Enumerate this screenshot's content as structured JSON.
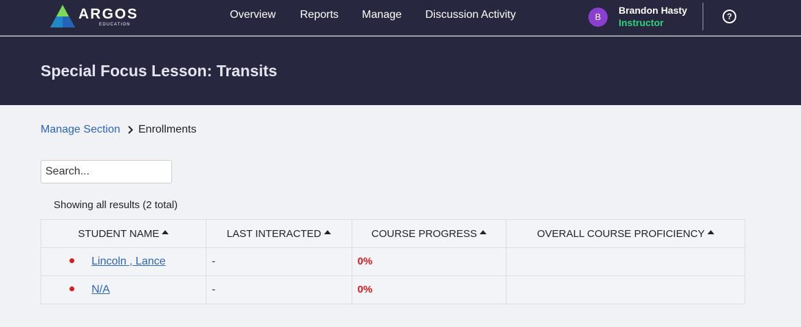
{
  "brand": {
    "name": "ARGOS",
    "sub": "EDUCATION"
  },
  "nav": [
    "Overview",
    "Reports",
    "Manage",
    "Discussion Activity"
  ],
  "user": {
    "initial": "B",
    "name": "Brandon Hasty",
    "role": "Instructor"
  },
  "help_icon": "?",
  "page_title": "Special Focus Lesson: Transits",
  "breadcrumb": {
    "parent": "Manage Section",
    "current": "Enrollments"
  },
  "search": {
    "placeholder": "Search..."
  },
  "results_text": "Showing all results (2 total)",
  "table": {
    "columns": [
      "STUDENT NAME",
      "LAST INTERACTED",
      "COURSE PROGRESS",
      "OVERALL COURSE PROFICIENCY"
    ],
    "rows": [
      {
        "name": "Lincoln , Lance",
        "last": "-",
        "progress": "0%",
        "proficiency": ""
      },
      {
        "name": "N/A",
        "last": "-",
        "progress": "0%",
        "proficiency": ""
      }
    ]
  },
  "colors": {
    "header_bg": "#272740",
    "link": "#2b64c6",
    "role": "#2fd47a",
    "alert": "#e0191b",
    "avatar": "#8a3fd1"
  }
}
